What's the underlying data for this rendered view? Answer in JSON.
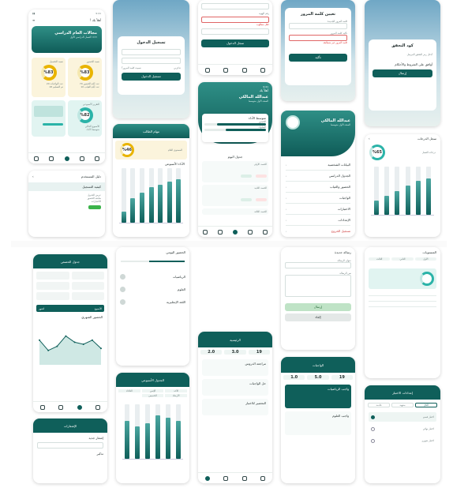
{
  "c1": {
    "time": "9:41",
    "greeting": "أهلاً بك !",
    "banner_title": "مجالات العام الدراسي",
    "banner_sub": "١٤٤٦ الفصل الدراسي الأول",
    "box1_title": "نسبة الحضور",
    "box1_val": "%83",
    "box2_title": "نسبة التحصيل",
    "box2_val": "%83",
    "box3_title": "التقرير الأسبوعي",
    "box3_val": "%82",
    "box1_lines": [
      "عدد أيام الحضور 70",
      "عدد أيام الغياب 10"
    ],
    "box2_lines": [
      "عدد الواجبات 20",
      "تم التسليم 18"
    ],
    "box3_lines": [
      "الأسبوع الحالي",
      "متوسط الأداء"
    ]
  },
  "c2": {
    "login_title": "تسجيل الدخول",
    "remember": "تذكرني",
    "forgot": "نسيت كلمة المرور؟",
    "login_btn": "تسجيل الدخول"
  },
  "c3": {
    "top_text": "سجل الدخول",
    "hint": "رقم الهوية",
    "error": "حقل مطلوب"
  },
  "c4": {
    "title": "تعيين كلمة المرور",
    "new_pass": "كلمة المرور الجديدة",
    "confirm_pass": "تأكيد كلمة المرور",
    "error": "كلمة المرور غير متطابقة",
    "btn": "تأكيد"
  },
  "c5": {
    "title": "كود التحقق",
    "hint": "أدخل رمز التحقق المرسل",
    "agree": "أوافق على الشروط والأحكام",
    "btn": "إرسال"
  },
  "c6": {
    "time": "9:41",
    "greeting": "أهلاً بك",
    "name": "عبدالله المالكي",
    "sub": "الصف الأول متوسط",
    "prog_title": "متوسط الأداء",
    "prog1": "الحضور",
    "prog2": "السلوك",
    "schedule_title": "جدول اليوم",
    "tags": [
      "الحصة الأولى",
      "الحصة الثانية",
      "الحصة الثالثة"
    ]
  },
  "c7": {
    "name": "عبدالله المالكي",
    "sub": "الصف الأول متوسط",
    "menu": [
      "البيانات الشخصية",
      "الجدول الدراسي",
      "الحضور والغياب",
      "الواجبات",
      "الاختبارات",
      "الإعدادات",
      "تسجيل الخروج"
    ]
  },
  "c8": {
    "title": "مهام الطالب",
    "level": "المستوى العام",
    "val": "%46",
    "chart_title": "الأداء الأسبوعي"
  },
  "c9": {
    "title": "دليل المستخدم",
    "items": [
      "كيفية التسجيل",
      "عرض الجدول",
      "متابعة الحضور",
      "الاختبارات"
    ]
  },
  "c10": {
    "title": "سجل الدرجات",
    "val": "%65",
    "chart_title": "درجات الفصل",
    "lines": [
      "الرياضيات",
      "العلوم",
      "اللغة العربية"
    ]
  },
  "c11": {
    "title": "جدول الحصص",
    "chart_title": "الحضور الشهري",
    "tabs": [
      "الأسبوع",
      "الشهر"
    ]
  },
  "c12": {
    "title": "الحضور اليومي",
    "items": [
      "الرياضيات",
      "العلوم",
      "اللغة الإنجليزية"
    ]
  },
  "c13": {
    "title": "الجدول الأسبوعي",
    "days": [
      "الأحد",
      "الإثنين",
      "الثلاثاء",
      "الأربعاء",
      "الخميس"
    ]
  },
  "c14": {
    "title": "رسالة جديدة",
    "label1": "عنوان الرسالة",
    "label2": "نص الرسالة",
    "btn": "إرسال",
    "btn2": "إلغاء"
  },
  "c15": {
    "title": "الرئيسية",
    "stats": [
      "19",
      "3.0",
      "2.0"
    ],
    "items": [
      "مراجعة الدروس",
      "حل الواجبات",
      "التحضير للاختبار"
    ]
  },
  "c16": {
    "title": "الواجبات",
    "stats": [
      "19",
      "5.0",
      "1.0"
    ],
    "items": [
      "واجب الرياضيات",
      "واجب العلوم"
    ]
  },
  "c17": {
    "title": "إعدادات الاختبار",
    "tabs": [
      "الكل",
      "منتهية",
      "قادمة"
    ],
    "options": [
      "اختبار قصير",
      "اختبار نهائي",
      "اختبار شهري"
    ]
  },
  "c18": {
    "title": "الإشعارات",
    "items": [
      "إشعار جديد",
      "تذكير"
    ]
  },
  "c19": {
    "title": "المستويات",
    "tabs": [
      "الأول",
      "الثاني",
      "الثالث"
    ]
  },
  "chart_data": [
    {
      "type": "bar",
      "name_ref": "c8",
      "values": [
        20,
        45,
        55,
        65,
        70,
        75,
        80
      ]
    },
    {
      "type": "bar",
      "name_ref": "c10",
      "values": [
        30,
        40,
        50,
        60,
        70,
        75
      ]
    },
    {
      "type": "line",
      "name_ref": "c11",
      "values": [
        60,
        35,
        45,
        70,
        55,
        50,
        60,
        40
      ]
    },
    {
      "type": "bar",
      "name_ref": "c13",
      "values": [
        70,
        60,
        65,
        80,
        75,
        70
      ]
    }
  ]
}
